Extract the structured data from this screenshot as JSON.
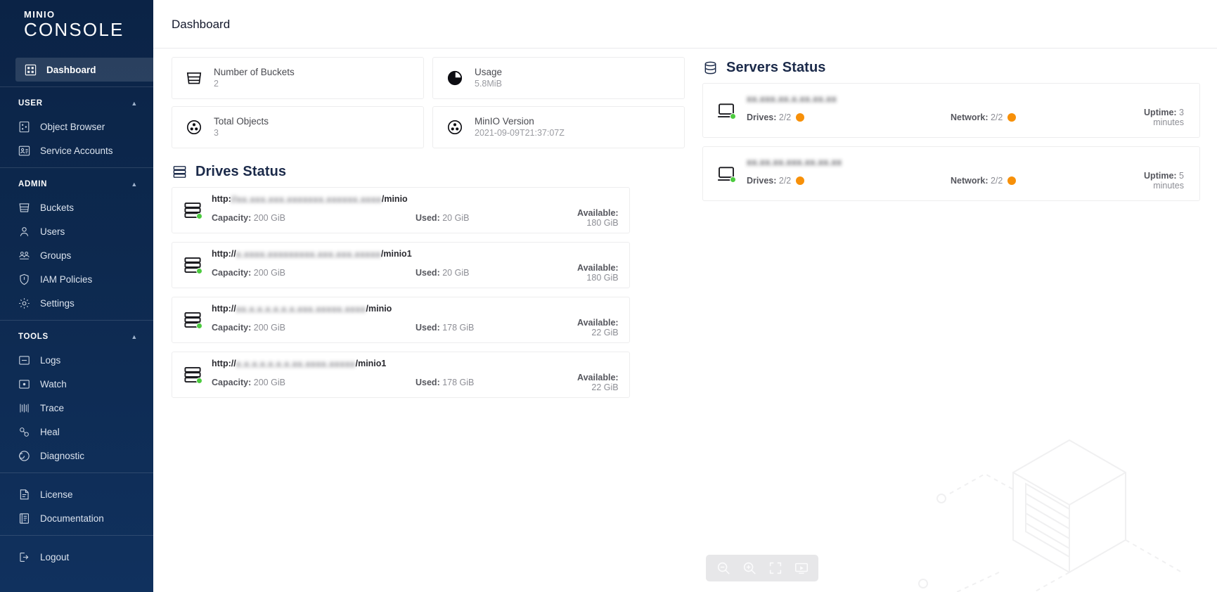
{
  "brand": {
    "mini": "MINIO",
    "console": "CONSOLE"
  },
  "sidebar": {
    "dashboard": {
      "label": "Dashboard",
      "icon": "dashboard-icon"
    },
    "groups": [
      {
        "title": "USER",
        "caret": "▲",
        "items": [
          {
            "label": "Object Browser",
            "icon": "object-browser-icon"
          },
          {
            "label": "Service Accounts",
            "icon": "service-accounts-icon"
          }
        ]
      },
      {
        "title": "ADMIN",
        "caret": "▲",
        "items": [
          {
            "label": "Buckets",
            "icon": "bucket-icon"
          },
          {
            "label": "Users",
            "icon": "user-icon"
          },
          {
            "label": "Groups",
            "icon": "groups-icon"
          },
          {
            "label": "IAM Policies",
            "icon": "shield-icon"
          },
          {
            "label": "Settings",
            "icon": "gear-icon"
          }
        ]
      },
      {
        "title": "TOOLS",
        "caret": "▲",
        "items": [
          {
            "label": "Logs",
            "icon": "logs-icon"
          },
          {
            "label": "Watch",
            "icon": "watch-icon"
          },
          {
            "label": "Trace",
            "icon": "trace-icon"
          },
          {
            "label": "Heal",
            "icon": "heal-icon"
          },
          {
            "label": "Diagnostic",
            "icon": "diagnostic-icon"
          }
        ]
      }
    ],
    "footer_items": [
      {
        "label": "License",
        "icon": "license-icon"
      },
      {
        "label": "Documentation",
        "icon": "documentation-icon"
      }
    ],
    "logout": {
      "label": "Logout",
      "icon": "logout-icon"
    }
  },
  "header": {
    "title": "Dashboard"
  },
  "info_cards": [
    {
      "label": "Number of Buckets",
      "value": "2",
      "icon": "bucket-icon"
    },
    {
      "label": "Usage",
      "value": "5.8MiB",
      "icon": "pie-usage-icon"
    },
    {
      "label": "Total Objects",
      "value": "3",
      "icon": "objects-icon"
    },
    {
      "label": "MinIO Version",
      "value": "2021-09-09T21:37:07Z",
      "icon": "minio-version-icon"
    }
  ],
  "drives_section": {
    "title": "Drives Status",
    "icon": "drives-icon",
    "labels": {
      "capacity": "Capacity:",
      "used": "Used:",
      "available": "Available:"
    },
    "rows": [
      {
        "url_prefix": "http:",
        "url_redacted": "//xx.xxx.xxx.xxxxxxx.xxxxxx.xxxx",
        "url_suffix": "/minio",
        "capacity": "200 GiB",
        "used": "20 GiB",
        "available": "180 GiB",
        "status": "ok"
      },
      {
        "url_prefix": "http://",
        "url_redacted": "x.xxxx.xxxxxxxxx.xxx.xxx.xxxxx",
        "url_suffix": "/minio1",
        "capacity": "200 GiB",
        "used": "20 GiB",
        "available": "180 GiB",
        "status": "ok"
      },
      {
        "url_prefix": "http://",
        "url_redacted": "xx.x.x.x.x.x.x.xxx.xxxxx.xxxx",
        "url_suffix": "/minio",
        "capacity": "200 GiB",
        "used": "178 GiB",
        "available": "22 GiB",
        "status": "ok"
      },
      {
        "url_prefix": "http://",
        "url_redacted": "x.x.x.x.x.x.x.xx.xxxx.xxxxx",
        "url_suffix": "/minio1",
        "capacity": "200 GiB",
        "used": "178 GiB",
        "available": "22 GiB",
        "status": "ok"
      }
    ]
  },
  "servers_section": {
    "title": "Servers Status",
    "icon": "servers-icon",
    "labels": {
      "drives": "Drives:",
      "network": "Network:",
      "uptime": "Uptime:"
    },
    "rows": [
      {
        "host_redacted": "xx.xxx.xx.x.xx.xx.xx",
        "drives": "2/2",
        "drives_state": "warn",
        "network": "2/2",
        "network_state": "warn",
        "uptime": "3 minutes",
        "status": "ok"
      },
      {
        "host_redacted": "xx.xx.xx.xxx.xx.xx.xx",
        "drives": "2/2",
        "drives_state": "warn",
        "network": "2/2",
        "network_state": "warn",
        "uptime": "5 minutes",
        "status": "ok"
      }
    ]
  },
  "zoom_toolbar": {
    "buttons": [
      {
        "name": "zoom-out-icon"
      },
      {
        "name": "zoom-in-icon"
      },
      {
        "name": "fit-screen-icon"
      },
      {
        "name": "present-screen-icon"
      }
    ]
  },
  "colors": {
    "sidebar_bg": "#0b2346",
    "accent_blue": "#1b2a4a",
    "status_ok": "#4ccb3f",
    "status_warn": "#f79009",
    "card_border": "#ededee",
    "muted_text": "#8d8e95"
  }
}
